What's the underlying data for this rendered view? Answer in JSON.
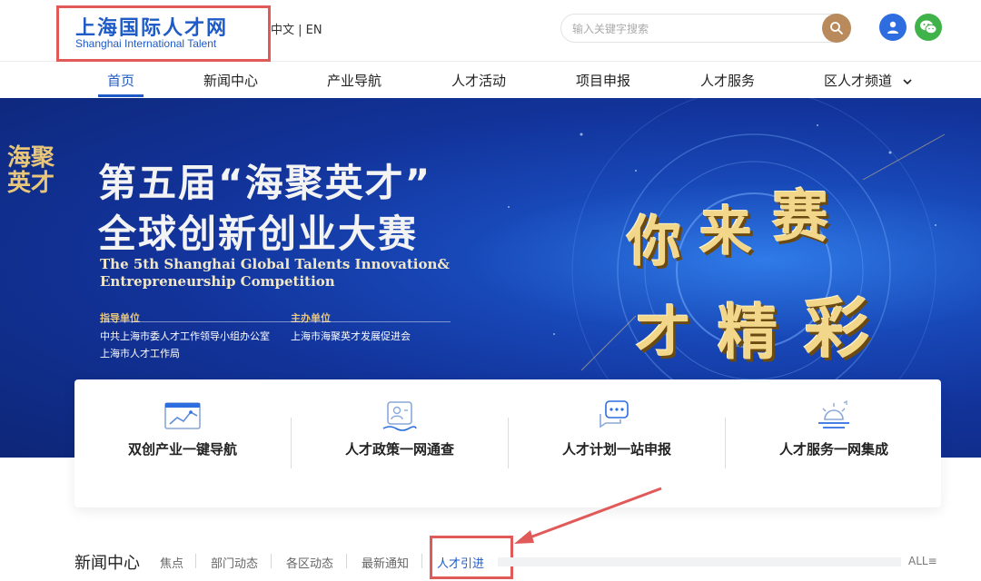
{
  "header": {
    "logo_cn": "上海国际人才网",
    "logo_en": "Shanghai International Talent",
    "lang": "中文 | EN",
    "search_placeholder": "输入关键字搜索",
    "icons": {
      "search": "search-icon",
      "user": "user-icon",
      "wechat": "wechat-icon"
    }
  },
  "nav": {
    "items": [
      {
        "label": "首页"
      },
      {
        "label": "新闻中心"
      },
      {
        "label": "产业导航"
      },
      {
        "label": "人才活动"
      },
      {
        "label": "项目申报"
      },
      {
        "label": "人才服务"
      },
      {
        "label": "区人才频道"
      }
    ],
    "active_index": 0
  },
  "banner": {
    "mark": "海聚英才",
    "title_line1": "第五届“海聚英才”",
    "title_line2": "全球创新创业大赛",
    "en_line1": "The 5th Shanghai Global Talents Innovation&",
    "en_line2": "Entrepreneurship Competition",
    "guide_label": "指导单位",
    "guide_org1": "中共上海市委人才工作领导小组办公室",
    "guide_org2": "上海市人才工作局",
    "host_label": "主办单位",
    "host_org": "上海市海聚英才发展促进会",
    "slogan": [
      "你",
      "来",
      "赛",
      "才",
      "精",
      "彩"
    ]
  },
  "cards": [
    {
      "label": "双创产业一键导航",
      "icon": "chart-icon"
    },
    {
      "label": "人才政策一网通查",
      "icon": "profile-card-icon"
    },
    {
      "label": "人才计划一站申报",
      "icon": "chat-bubble-icon"
    },
    {
      "label": "人才服务一网集成",
      "icon": "sunrise-icon"
    }
  ],
  "news": {
    "title": "新闻中心",
    "tabs": [
      "焦点",
      "部门动态",
      "各区动态",
      "最新通知",
      "人才引进"
    ],
    "active_tab": "人才引进",
    "all_label": "ALL≡"
  },
  "colors": {
    "brand_blue": "#1e5bc6",
    "search_button": "#b98a5b",
    "user_button": "#2d6de0",
    "wechat_button": "#3fb34a",
    "annotation_red": "#e05a5a",
    "banner_dark": "#0d2677"
  }
}
